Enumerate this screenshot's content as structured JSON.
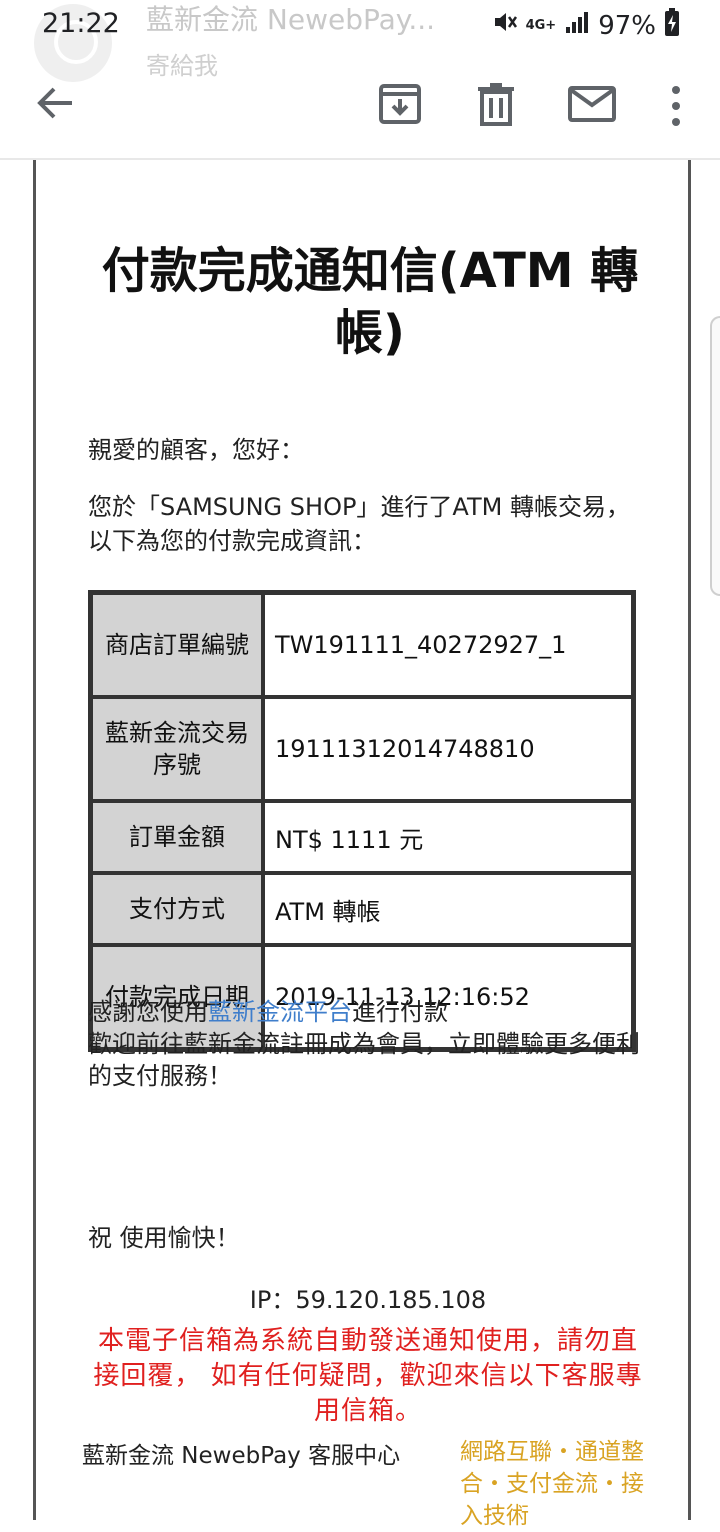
{
  "status": {
    "time": "21:22",
    "battery": "97%",
    "network": "4G+"
  },
  "ghost_header": {
    "sender": "藍新金流 NewebPay...",
    "to": "寄給我"
  },
  "app_bar": {
    "icons": [
      "arrow-back-icon",
      "archive-icon",
      "delete-icon",
      "mail-icon",
      "more-vert-icon"
    ]
  },
  "email": {
    "title": "付款完成通知信(ATM 轉帳)",
    "greeting": "親愛的顧客，您好：",
    "intro": "您於「SAMSUNG SHOP」進行了ATM 轉帳交易，以下為您的付款完成資訊：",
    "table": [
      {
        "label": "商店訂單編號",
        "value": "TW191111_40272927_1"
      },
      {
        "label": "藍新金流交易序號",
        "value": "19111312014748810"
      },
      {
        "label": "訂單金額",
        "value": "NT$ 1111 元"
      },
      {
        "label": "支付方式",
        "value": "ATM 轉帳"
      },
      {
        "label": "付款完成日期",
        "value": "2019-11-13 12:16:52"
      }
    ],
    "thanks_prefix": "感謝您使用",
    "thanks_link": "藍新金流平台",
    "thanks_suffix": "進行付款",
    "thanks_line2": "歡迎前往藍新金流註冊成為會員，立即體驗更多便利的支付服務！",
    "wish": "祝 使用愉快！",
    "ip": "IP：59.120.185.108",
    "notice": "本電子信箱為系統自動發送通知使用，請勿直接回覆， 如有任何疑問，歡迎來信以下客服專用信箱。",
    "footer_left": "藍新金流 NewebPay 客服中心",
    "footer_right": "網路互聯・通道整合・支付金流・接入技術"
  },
  "colors": {
    "link": "#3f7ecb",
    "notice": "#e0201f",
    "footer_accent": "#d9a323",
    "table_header_bg": "#d3d3d3"
  }
}
